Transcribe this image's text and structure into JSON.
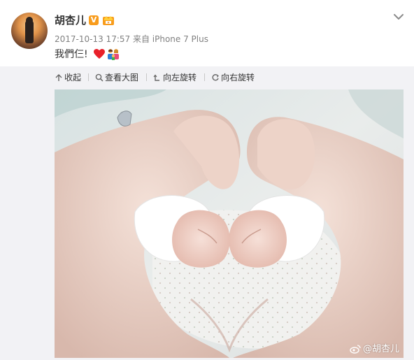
{
  "post": {
    "author": "胡杏儿",
    "verified_mark": "V",
    "timestamp": "2017-10-13 17:57",
    "source": "来自 iPhone 7 Plus",
    "text": "我們仨!",
    "emojis": [
      "heart-emoji",
      "family-emoji"
    ]
  },
  "toolbar": {
    "collapse_label": "收起",
    "view_large_label": "查看大图",
    "rotate_left_label": "向左旋转",
    "rotate_right_label": "向右旋转"
  },
  "image": {
    "watermark": "@胡杏儿"
  },
  "colors": {
    "username": "#333333",
    "meta": "#808080",
    "badge": "#f89c1c",
    "panel_bg": "#f2f2f5"
  }
}
